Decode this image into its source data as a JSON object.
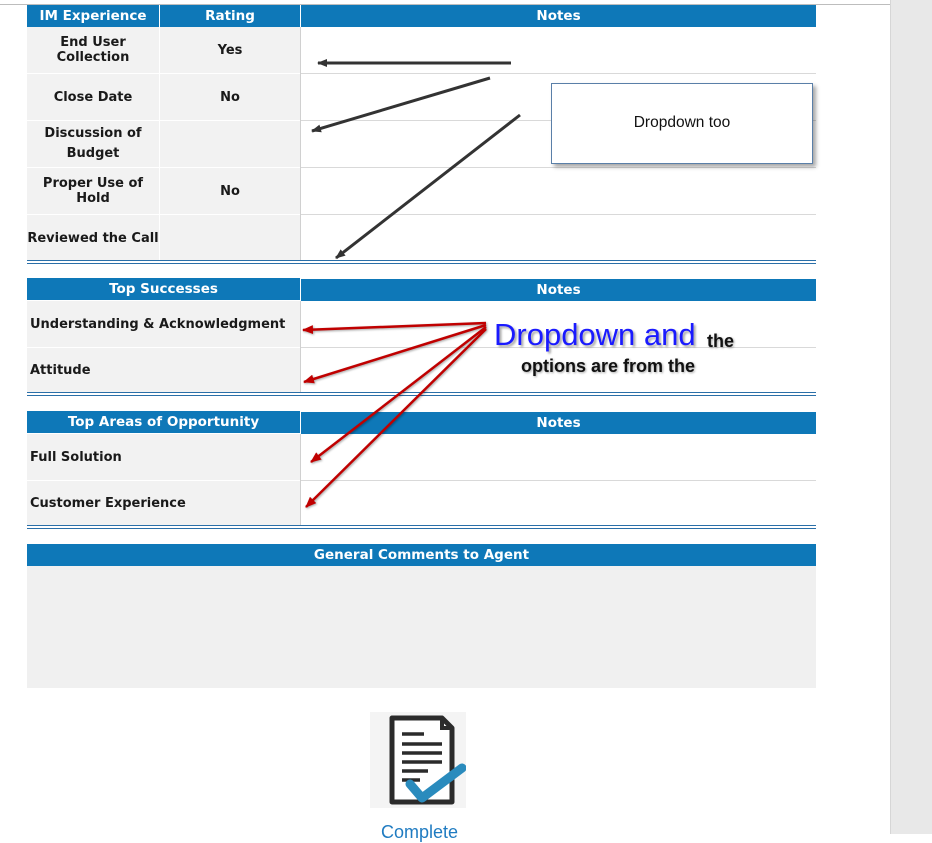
{
  "im_experience": {
    "headers": {
      "category": "IM Experience",
      "rating": "Rating",
      "notes": "Notes"
    },
    "rows": [
      {
        "label": "End User Collection",
        "rating": "Yes"
      },
      {
        "label": "Close Date",
        "rating": "No"
      },
      {
        "label": "Discussion of Budget",
        "rating": ""
      },
      {
        "label": "Proper Use of Hold",
        "rating": "No"
      },
      {
        "label": "Reviewed the Call",
        "rating": ""
      }
    ]
  },
  "top_successes": {
    "headers": {
      "category": "Top Successes",
      "notes": "Notes"
    },
    "rows": [
      {
        "label": "Understanding & Acknowledgment"
      },
      {
        "label": "Attitude"
      }
    ]
  },
  "top_opportunity": {
    "headers": {
      "category": "Top Areas of Opportunity",
      "notes": "Notes"
    },
    "rows": [
      {
        "label": "Full Solution"
      },
      {
        "label": "Customer Experience"
      }
    ]
  },
  "general_comments": {
    "header": "General Comments to Agent",
    "value": ""
  },
  "annotations": {
    "callout": "Dropdown too",
    "big_main": "Dropdown and",
    "big_tail": "the",
    "big_line2": "options are from the"
  },
  "complete": {
    "label": "Complete",
    "icon": "document-check-icon"
  },
  "colors": {
    "header_bg": "#0e78b8",
    "cell_bg": "#f2f2f2",
    "accent_text": "#1a1aff",
    "arrow_red": "#c00000",
    "arrow_dark": "#333333"
  }
}
